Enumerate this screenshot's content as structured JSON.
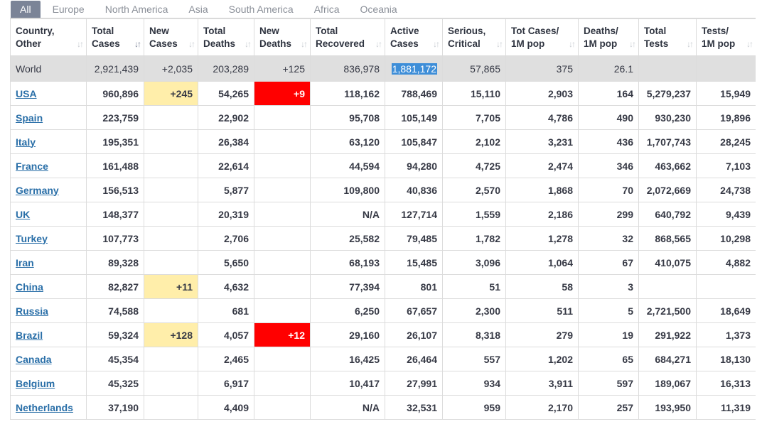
{
  "tabs": [
    "All",
    "Europe",
    "North America",
    "Asia",
    "South America",
    "Africa",
    "Oceania"
  ],
  "active_tab": "All",
  "columns": [
    {
      "line1": "Country,",
      "line2": "Other"
    },
    {
      "line1": "Total",
      "line2": "Cases"
    },
    {
      "line1": "New",
      "line2": "Cases"
    },
    {
      "line1": "Total",
      "line2": "Deaths"
    },
    {
      "line1": "New",
      "line2": "Deaths"
    },
    {
      "line1": "Total",
      "line2": "Recovered"
    },
    {
      "line1": "Active",
      "line2": "Cases"
    },
    {
      "line1": "Serious,",
      "line2": "Critical"
    },
    {
      "line1": "Tot Cases/",
      "line2": "1M pop"
    },
    {
      "line1": "Deaths/",
      "line2": "1M pop"
    },
    {
      "line1": "Total",
      "line2": "Tests"
    },
    {
      "line1": "Tests/",
      "line2": "1M pop"
    }
  ],
  "sort_icon": "sort-arrows-icon",
  "highlight_colors": {
    "new_cases": "#ffeeaa",
    "new_deaths": "#ff0000",
    "selection": "#3e8ed8"
  },
  "world": [
    "World",
    "2,921,439",
    "+2,035",
    "203,289",
    "+125",
    "836,978",
    "1,881,172",
    "57,865",
    "375",
    "26.1",
    "",
    ""
  ],
  "rows": [
    [
      "USA",
      "960,896",
      "+245",
      "54,265",
      "+9",
      "118,162",
      "788,469",
      "15,110",
      "2,903",
      "164",
      "5,279,237",
      "15,949"
    ],
    [
      "Spain",
      "223,759",
      "",
      "22,902",
      "",
      "95,708",
      "105,149",
      "7,705",
      "4,786",
      "490",
      "930,230",
      "19,896"
    ],
    [
      "Italy",
      "195,351",
      "",
      "26,384",
      "",
      "63,120",
      "105,847",
      "2,102",
      "3,231",
      "436",
      "1,707,743",
      "28,245"
    ],
    [
      "France",
      "161,488",
      "",
      "22,614",
      "",
      "44,594",
      "94,280",
      "4,725",
      "2,474",
      "346",
      "463,662",
      "7,103"
    ],
    [
      "Germany",
      "156,513",
      "",
      "5,877",
      "",
      "109,800",
      "40,836",
      "2,570",
      "1,868",
      "70",
      "2,072,669",
      "24,738"
    ],
    [
      "UK",
      "148,377",
      "",
      "20,319",
      "",
      "N/A",
      "127,714",
      "1,559",
      "2,186",
      "299",
      "640,792",
      "9,439"
    ],
    [
      "Turkey",
      "107,773",
      "",
      "2,706",
      "",
      "25,582",
      "79,485",
      "1,782",
      "1,278",
      "32",
      "868,565",
      "10,298"
    ],
    [
      "Iran",
      "89,328",
      "",
      "5,650",
      "",
      "68,193",
      "15,485",
      "3,096",
      "1,064",
      "67",
      "410,075",
      "4,882"
    ],
    [
      "China",
      "82,827",
      "+11",
      "4,632",
      "",
      "77,394",
      "801",
      "51",
      "58",
      "3",
      "",
      ""
    ],
    [
      "Russia",
      "74,588",
      "",
      "681",
      "",
      "6,250",
      "67,657",
      "2,300",
      "511",
      "5",
      "2,721,500",
      "18,649"
    ],
    [
      "Brazil",
      "59,324",
      "+128",
      "4,057",
      "+12",
      "29,160",
      "26,107",
      "8,318",
      "279",
      "19",
      "291,922",
      "1,373"
    ],
    [
      "Canada",
      "45,354",
      "",
      "2,465",
      "",
      "16,425",
      "26,464",
      "557",
      "1,202",
      "65",
      "684,271",
      "18,130"
    ],
    [
      "Belgium",
      "45,325",
      "",
      "6,917",
      "",
      "10,417",
      "27,991",
      "934",
      "3,911",
      "597",
      "189,067",
      "16,313"
    ],
    [
      "Netherlands",
      "37,190",
      "",
      "4,409",
      "",
      "N/A",
      "32,531",
      "959",
      "2,170",
      "257",
      "193,950",
      "11,319"
    ]
  ]
}
